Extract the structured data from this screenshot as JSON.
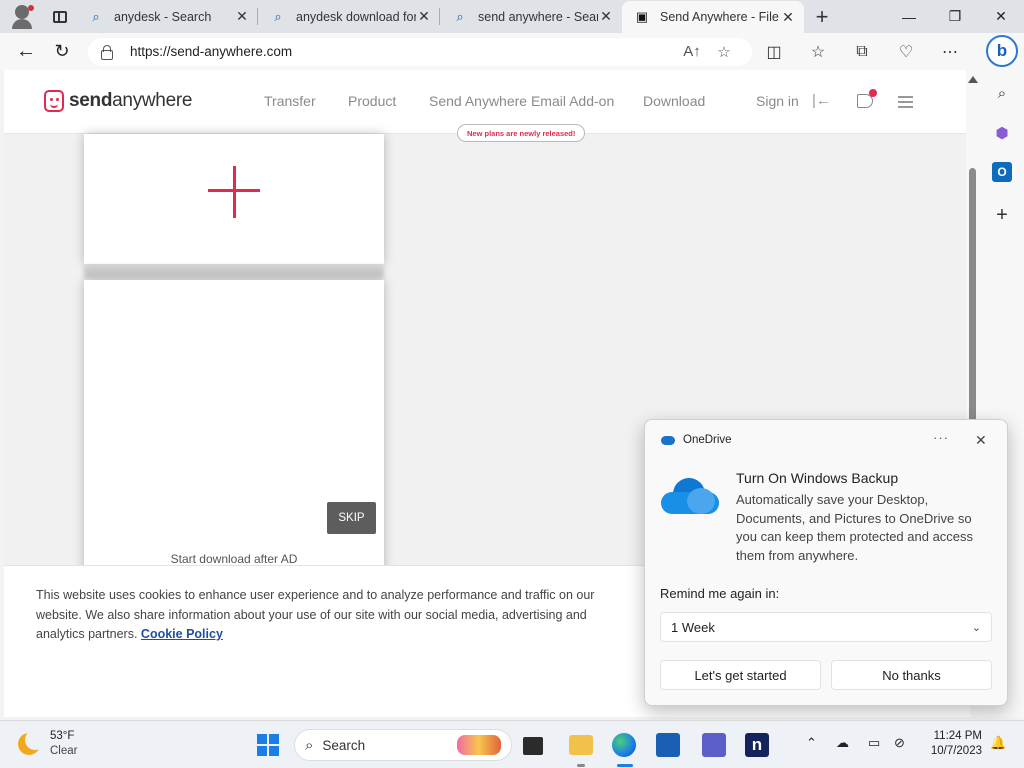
{
  "browser": {
    "tabs": [
      {
        "label": "anydesk - Search",
        "icon": "search-icon"
      },
      {
        "label": "anydesk download for",
        "icon": "search-icon"
      },
      {
        "label": "send anywhere - Sear",
        "icon": "search-icon"
      },
      {
        "label": "Send Anywhere - File S",
        "icon": "sendanywhere-icon",
        "active": true
      }
    ],
    "url": "https://send-anywhere.com"
  },
  "site": {
    "logo_prefix": "send",
    "logo_suffix": "anywhere",
    "nav": [
      "Transfer",
      "Product",
      "Send Anywhere Email Add-on",
      "Download"
    ],
    "badge": "New plans are newly released!",
    "signin": "Sign in",
    "accent_color": "#e2294f"
  },
  "ad": {
    "skip_label": "SKIP",
    "start_download_text": "Start download after AD"
  },
  "cookie": {
    "text": "This website uses cookies to enhance user experience and to analyze performance and traffic on our website. We also share information about your use of our site with our social media, advertising and analytics partners.",
    "link": "Cookie Policy"
  },
  "onedrive": {
    "app_name": "OneDrive",
    "more": "···",
    "title": "Turn On Windows Backup",
    "description": "Automatically save your Desktop, Documents, and Pictures to OneDrive so you can keep them protected and access them from anywhere.",
    "remind_label": "Remind me again in:",
    "remind_value": "1 Week",
    "primary_button": "Let's get started",
    "secondary_button": "No thanks"
  },
  "taskbar": {
    "temperature": "53°F",
    "condition": "Clear",
    "search_label": "Search",
    "time": "11:24 PM",
    "date": "10/7/2023"
  }
}
